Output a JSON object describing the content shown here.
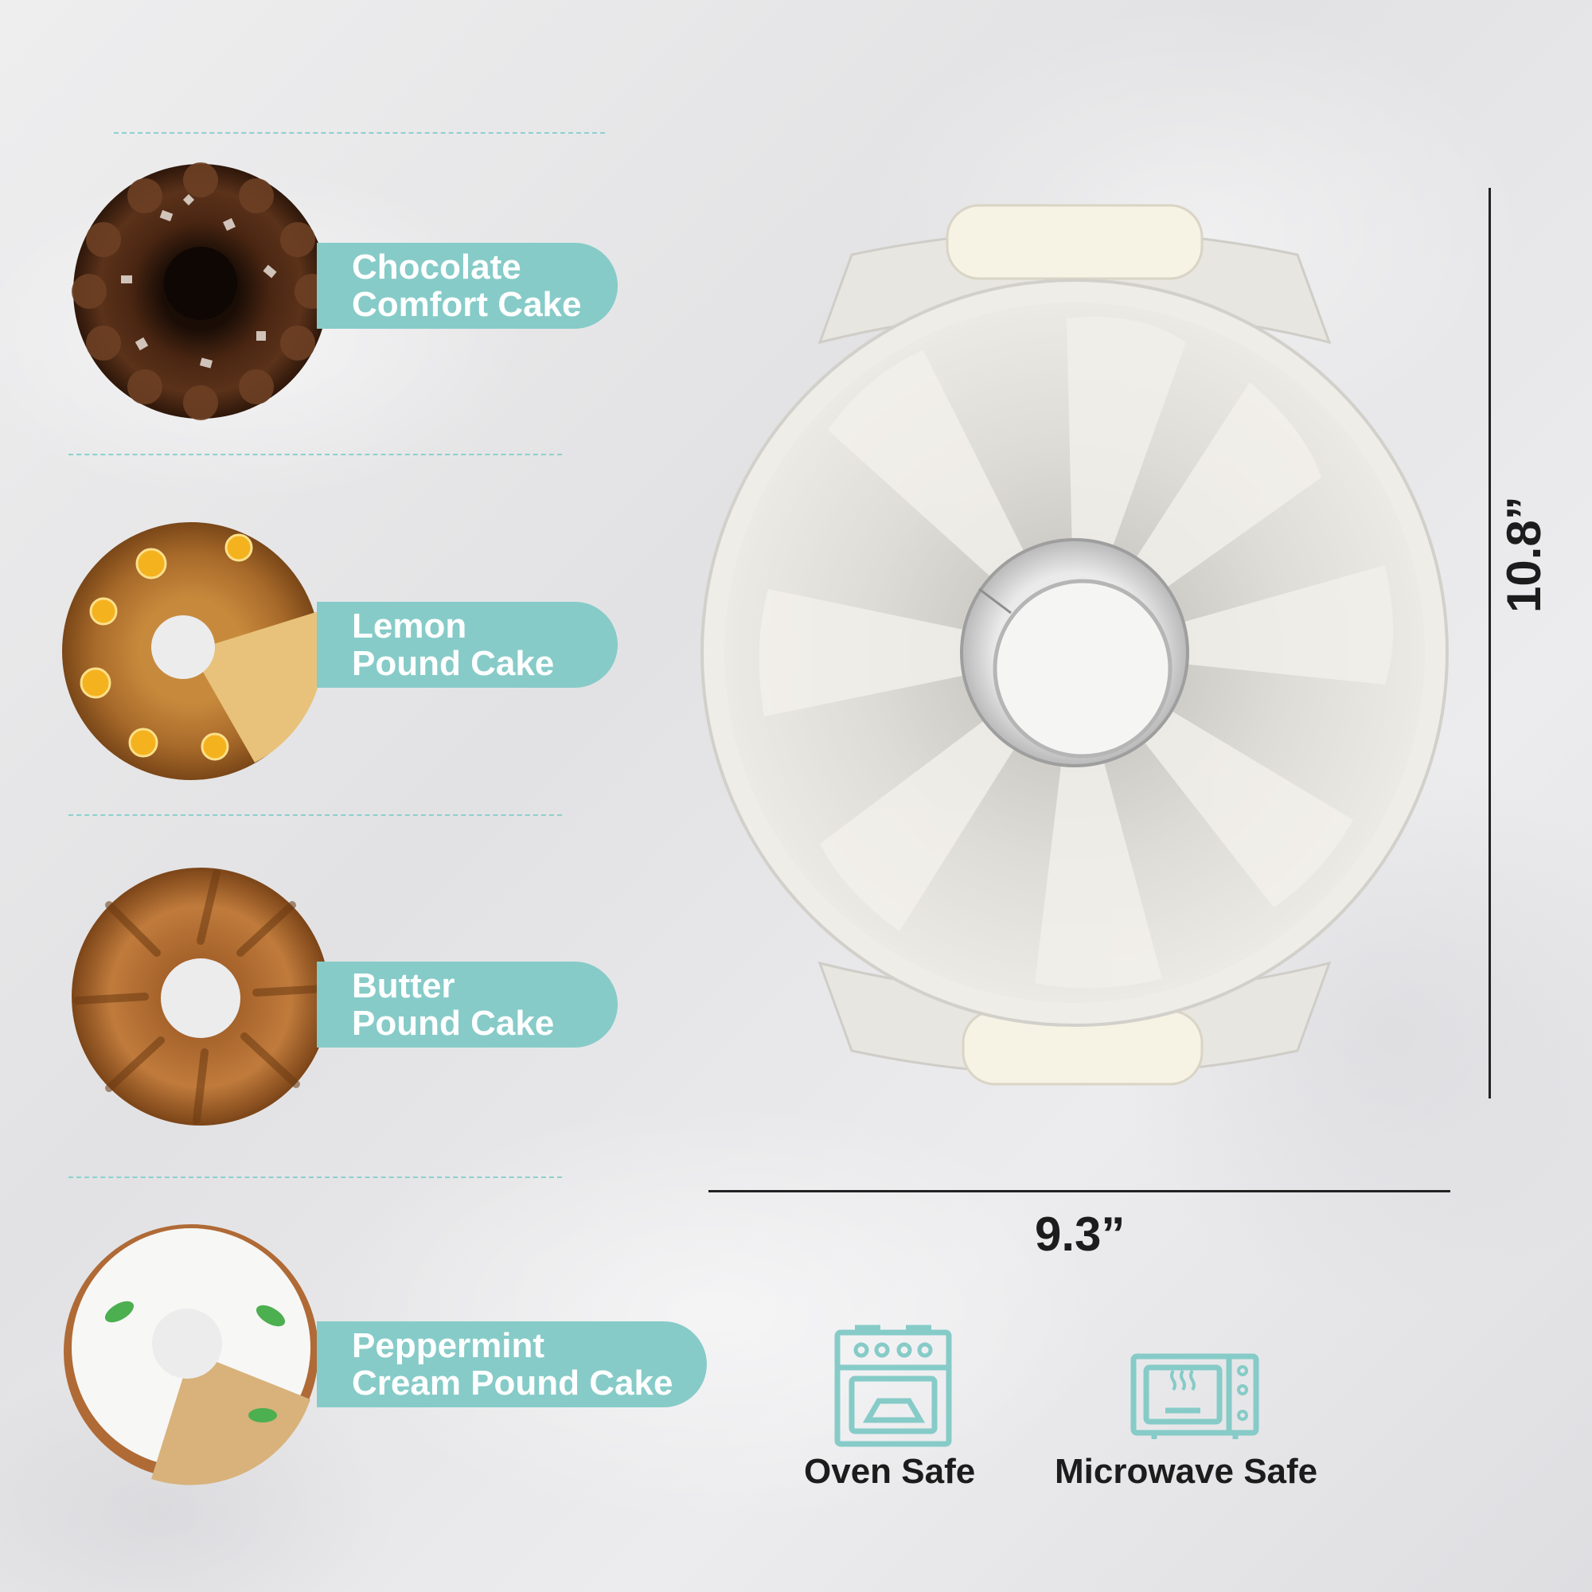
{
  "recipes": [
    {
      "line1": "Chocolate",
      "line2": "Comfort Cake"
    },
    {
      "line1": "Lemon",
      "line2": "Pound Cake"
    },
    {
      "line1": "Butter",
      "line2": "Pound Cake"
    },
    {
      "line1": "Peppermint",
      "line2": "Cream Pound Cake"
    }
  ],
  "dimensions": {
    "height": "10.8”",
    "width": "9.3”"
  },
  "features": {
    "oven": "Oven Safe",
    "microwave": "Microwave Safe"
  },
  "colors": {
    "accent_teal": "#86cbc8",
    "text_dark": "#1c1c1c",
    "pan_body": "#e4e2dc",
    "handle": "#f6f2e4"
  }
}
